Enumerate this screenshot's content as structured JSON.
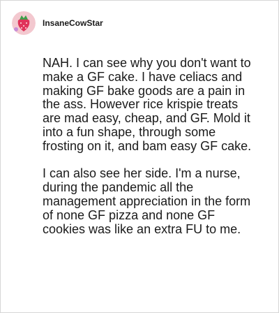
{
  "post": {
    "username": "InsaneCowStar",
    "paragraphs": [
      "NAH. I can see why you don't want to make a GF cake. I have celiacs and making GF bake goods are a pain in the ass. However rice krispie treats are mad easy, cheap, and GF. Mold it into a fun shape, through some frosting on it, and bam easy GF cake.",
      "I can also see her side. I'm a nurse, during the pandemic all the management appreciation in the form of none GF pizza and none GF cookies was like an extra FU to me."
    ]
  },
  "avatar": {
    "icon": "strawberry-avatar-icon",
    "colors": {
      "background": "#f3c8cf",
      "strawberry": "#e0335a",
      "leaves": "#3f9e4a"
    }
  }
}
